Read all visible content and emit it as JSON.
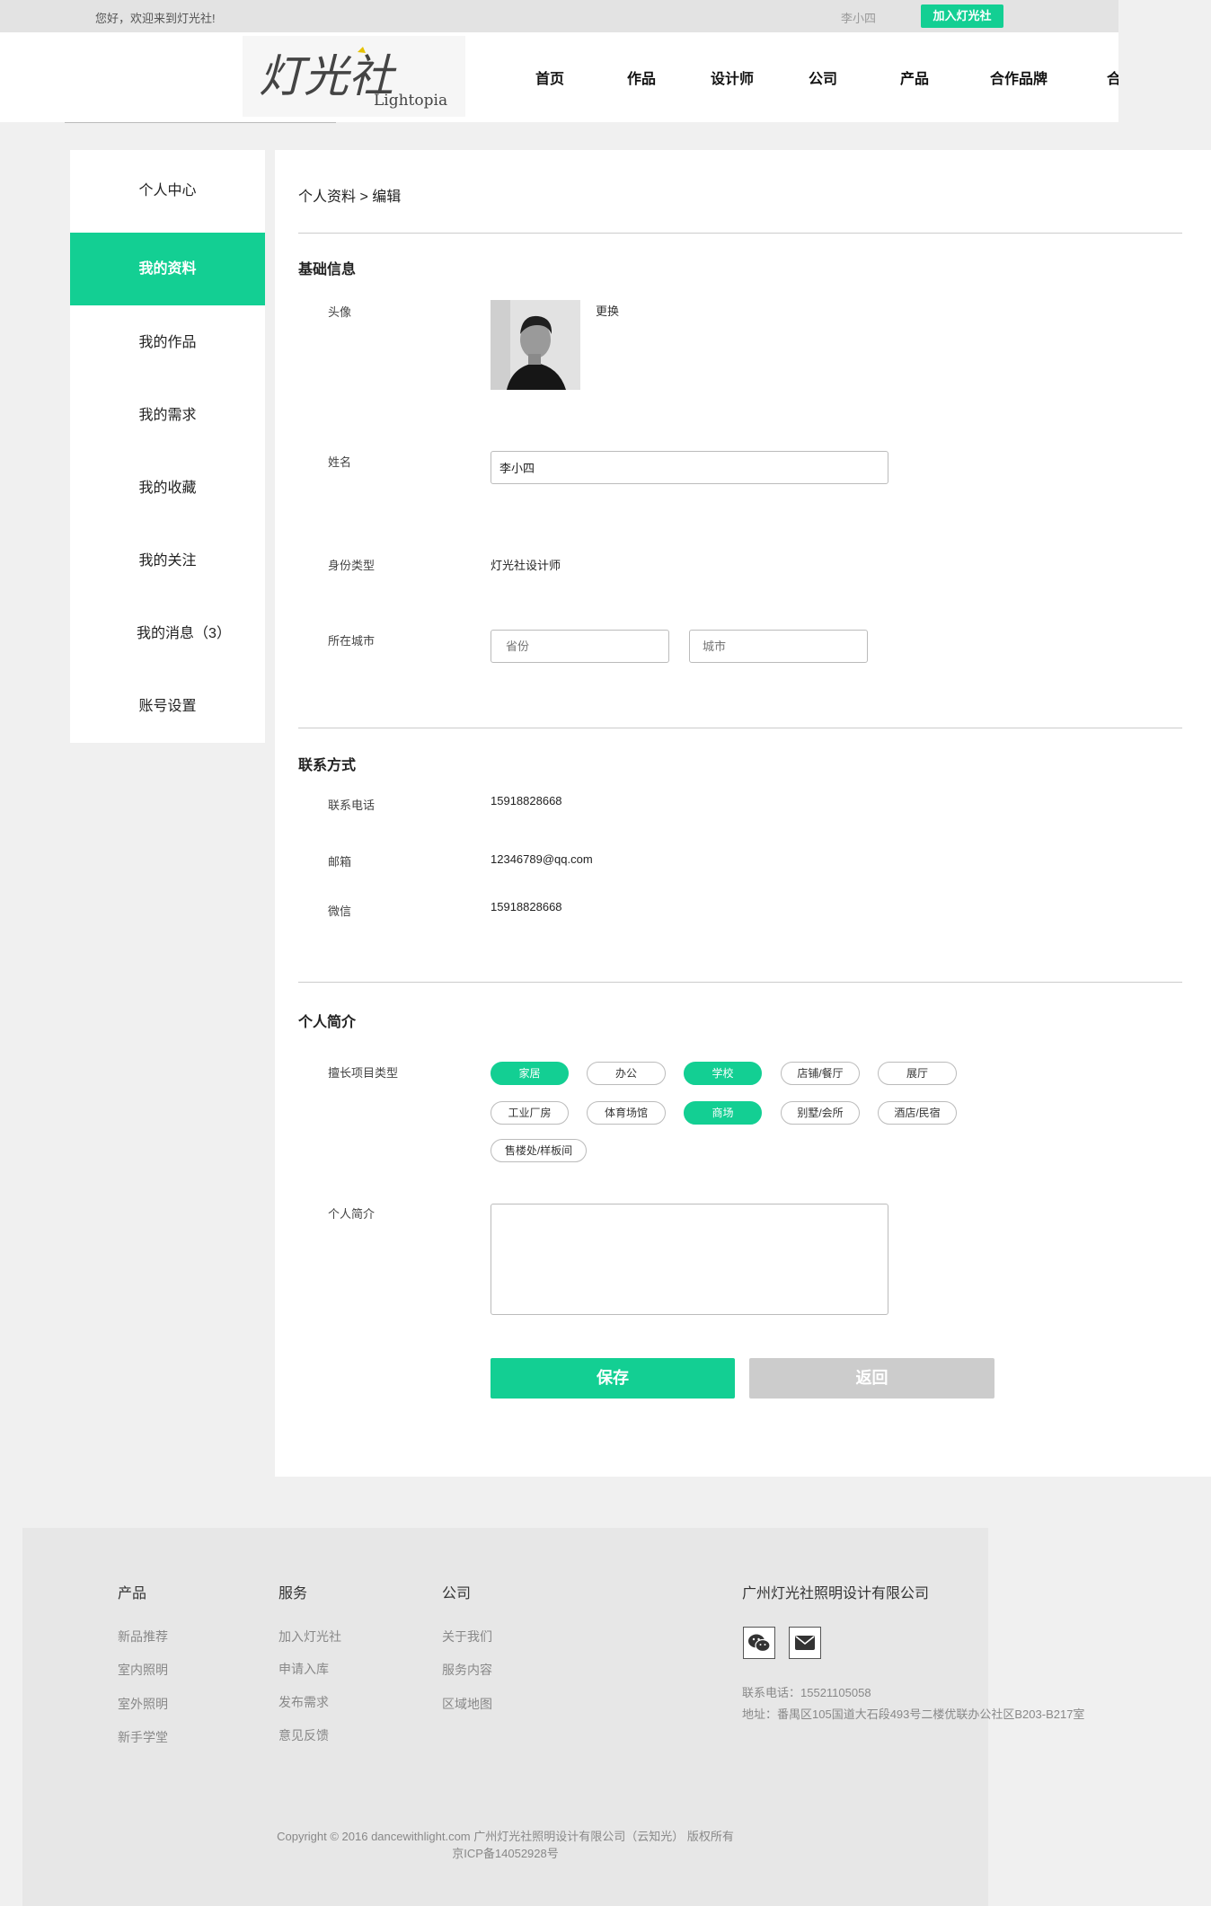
{
  "topbar": {
    "welcome": "您好，欢迎来到灯光社!",
    "user_name": "李小四",
    "join_label": "加入灯光社"
  },
  "header": {
    "logo_text": "灯光社",
    "logo_sub": "Lightopia",
    "nav": [
      "首页",
      "作品",
      "设计师",
      "公司",
      "产品",
      "合作品牌",
      "合"
    ]
  },
  "sidebar": {
    "items": [
      {
        "label": "个人中心",
        "active": false
      },
      {
        "label": "我的资料",
        "active": true
      },
      {
        "label": "我的作品",
        "active": false
      },
      {
        "label": "我的需求",
        "active": false
      },
      {
        "label": "我的收藏",
        "active": false
      },
      {
        "label": "我的关注",
        "active": false
      },
      {
        "label": "我的消息（3）",
        "active": false
      },
      {
        "label": "账号设置",
        "active": false
      }
    ]
  },
  "main": {
    "breadcrumb": "个人资料 > 编辑",
    "basic": {
      "title": "基础信息",
      "avatar_label": "头像",
      "change_label": "更换",
      "name_label": "姓名",
      "name_value": "李小四",
      "identity_label": "身份类型",
      "identity_value": "灯光社设计师",
      "city_label": "所在城市",
      "province_placeholder": "省份",
      "city_placeholder": "城市"
    },
    "contact": {
      "title": "联系方式",
      "phone_label": "联系电话",
      "phone_value": "15918828668",
      "email_label": "邮箱",
      "email_value": "12346789@qq.com",
      "wechat_label": "微信",
      "wechat_value": "15918828668"
    },
    "intro": {
      "title": "个人简介",
      "tags_label": "擅长项目类型",
      "tags": [
        {
          "label": "家居",
          "selected": true
        },
        {
          "label": "办公",
          "selected": false
        },
        {
          "label": "学校",
          "selected": true
        },
        {
          "label": "店铺/餐厅",
          "selected": false
        },
        {
          "label": "展厅",
          "selected": false
        },
        {
          "label": "工业厂房",
          "selected": false
        },
        {
          "label": "体育场馆",
          "selected": false
        },
        {
          "label": "商场",
          "selected": true
        },
        {
          "label": "别墅/会所",
          "selected": false
        },
        {
          "label": "酒店/民宿",
          "selected": false
        },
        {
          "label": "售楼处/样板间",
          "selected": false
        }
      ],
      "bio_label": "个人简介",
      "bio_value": ""
    },
    "save_label": "保存",
    "back_label": "返回"
  },
  "footer": {
    "col_product": {
      "title": "产品",
      "links": [
        "新品推荐",
        "室内照明",
        "室外照明",
        "新手学堂"
      ]
    },
    "col_service": {
      "title": "服务",
      "links": [
        "加入灯光社",
        "申请入库",
        "发布需求",
        "意见反馈"
      ]
    },
    "col_company": {
      "title": "公司",
      "links": [
        "关于我们",
        "服务内容",
        "区域地图"
      ]
    },
    "company_name": "广州灯光社照明设计有限公司",
    "phone": "联系电话：15521105058",
    "address": "地址：番禺区105国道大石段493号二楼优联办公社区B203-B217室",
    "copyright": "Copyright © 2016 dancewithlight.com 广州灯光社照明设计有限公司（云知光） 版权所有",
    "icp": "京ICP备14052928号"
  },
  "colors": {
    "accent": "#13cf93",
    "disabled_button": "#cccccc"
  },
  "icons": [
    "wechat-icon",
    "mail-icon",
    "avatar-photo"
  ]
}
